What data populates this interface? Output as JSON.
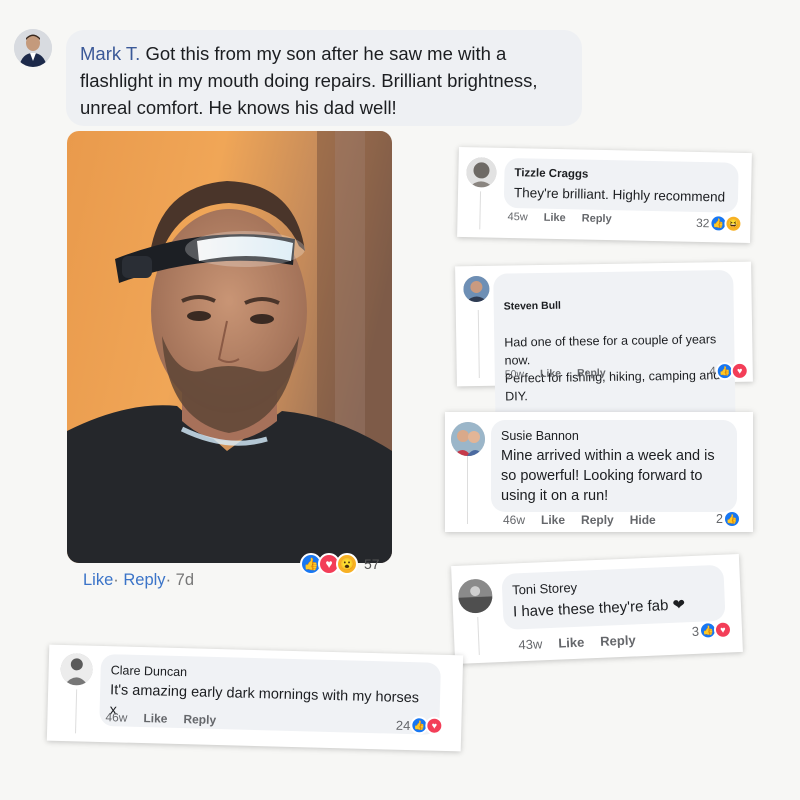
{
  "post": {
    "author": "Mark T.",
    "text": " Got this from my son after he saw me with a flashlight in my mouth doing repairs. Brilliant brightness, unreal comfort. He knows his dad well!",
    "reaction_count": "57",
    "reactions": [
      "like-icon",
      "love-icon",
      "wow-icon"
    ],
    "actions": {
      "like": "Like",
      "sep": "·",
      "reply": "Reply",
      "time": "7d"
    }
  },
  "comments": [
    {
      "name": "Tizzle Craggs",
      "text": "They're brilliant. Highly recommend",
      "time": "45w",
      "like": "Like",
      "reply": "Reply",
      "count": "32",
      "reactions": [
        "like-icon",
        "haha-icon"
      ]
    },
    {
      "name": "Steven Bull",
      "text": "Had one of these for a couple of years now.\nPerfect for fishing, hiking, camping and DIY.",
      "time": "50w",
      "like": "Like",
      "reply": "Reply",
      "count": "4",
      "reactions": [
        "like-icon",
        "love-icon"
      ]
    },
    {
      "name": "Susie Bannon",
      "text": "Mine arrived within a week and is so powerful! Looking forward to using it on a run!",
      "time": "46w",
      "like": "Like",
      "reply": "Reply",
      "hide": "Hide",
      "count": "2",
      "reactions": [
        "like-icon"
      ]
    },
    {
      "name": "Toni Storey",
      "text": "I have these they're fab ❤",
      "time": "43w",
      "like": "Like",
      "reply": "Reply",
      "count": "3",
      "reactions": [
        "like-icon",
        "love-icon"
      ]
    },
    {
      "name": "Clare Duncan",
      "text": "It's amazing early dark mornings with my horses x",
      "time": "46w",
      "like": "Like",
      "reply": "Reply",
      "count": "24",
      "reactions": [
        "like-icon",
        "love-icon"
      ]
    }
  ],
  "colors": {
    "link": "#3b74c8",
    "like": "#1877f2",
    "love": "#f33e58",
    "haha": "#f7b125",
    "bubble": "#f0f2f5"
  }
}
